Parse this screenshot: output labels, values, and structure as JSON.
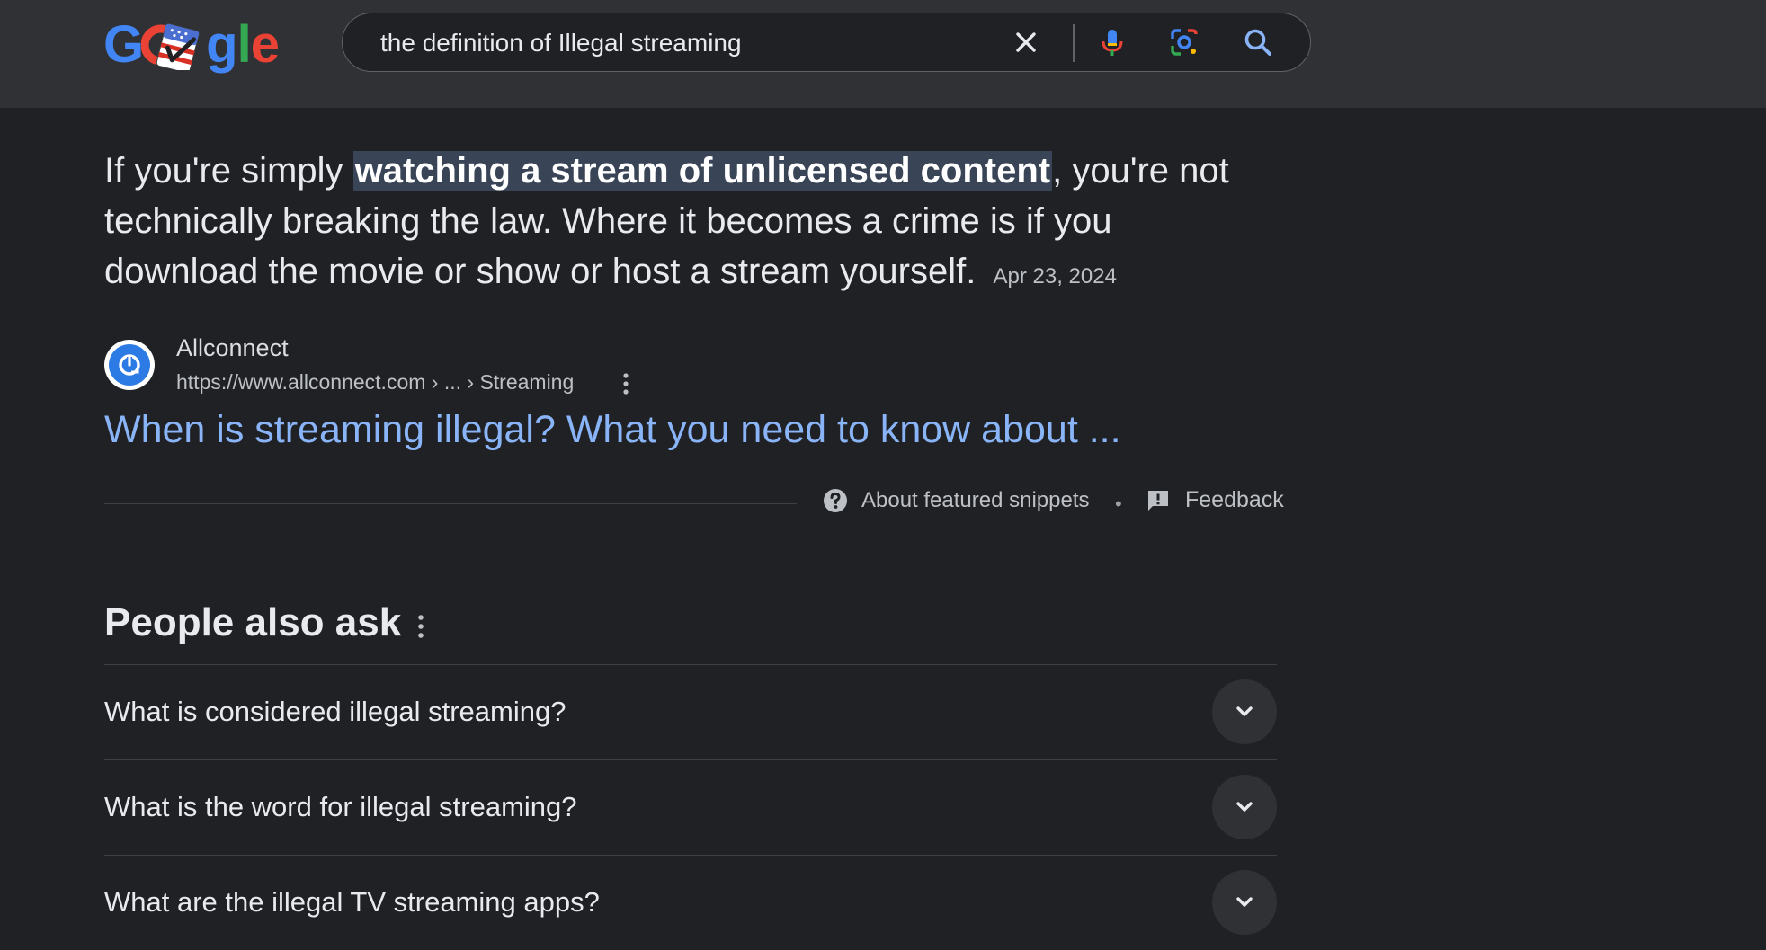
{
  "header": {
    "logo_letters": [
      {
        "char": "G",
        "color": "#4285f4"
      },
      {
        "char": "o",
        "color": "#ea4335"
      },
      {
        "char": "g",
        "color": "#4285f4"
      },
      {
        "char": "l",
        "color": "#34a853"
      },
      {
        "char": "e",
        "color": "#ea4335"
      }
    ],
    "search": {
      "value": "the definition of Illegal streaming",
      "clear_icon": "close-icon",
      "voice_icon": "microphone-icon",
      "lens_icon": "camera-lens-icon",
      "search_icon": "search-icon"
    }
  },
  "featured_snippet": {
    "text_before": "If you're simply ",
    "highlight": "watching a stream of unlicensed content",
    "text_after": ", you're not technically breaking the law. Where it becomes a crime is if you download the movie or show or host a stream yourself.",
    "date": "Apr 23, 2024",
    "source": {
      "name": "Allconnect",
      "url": "https://www.allconnect.com › ... › Streaming"
    },
    "title": "When is streaming illegal? What you need to know about ...",
    "about_label": "About featured snippets",
    "separator": "•",
    "feedback_label": "Feedback"
  },
  "people_also_ask": {
    "heading": "People also ask",
    "questions": [
      "What is considered illegal streaming?",
      "What is the word for illegal streaming?",
      "What are the illegal TV streaming apps?"
    ]
  },
  "colors": {
    "background": "#202124",
    "header_bg": "#303134",
    "link": "#8ab4f8",
    "highlight_bg": "#394457"
  }
}
